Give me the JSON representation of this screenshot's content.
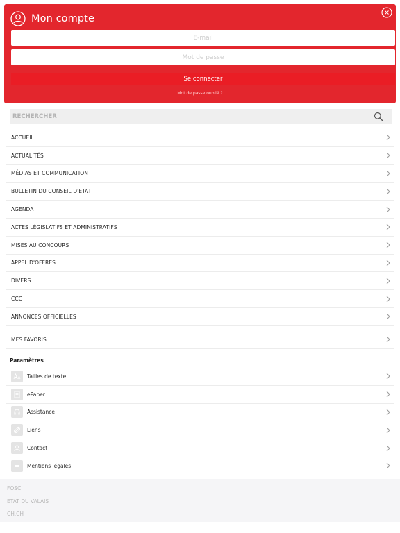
{
  "account": {
    "title": "Mon compte",
    "email_placeholder": "E-mail",
    "password_placeholder": "Mot de passe",
    "login_label": "Se connecter",
    "forgot_label": "Mot de passe oublié ?"
  },
  "search": {
    "placeholder": "RECHERCHER"
  },
  "menu": {
    "items": [
      {
        "label": "ACCUEIL"
      },
      {
        "label": "ACTUALITÉS"
      },
      {
        "label": "MÉDIAS ET COMMUNICATION"
      },
      {
        "label": "BULLETIN DU CONSEIL D'ETAT"
      },
      {
        "label": "AGENDA"
      },
      {
        "label": "ACTES LÉGISLATIFS ET ADMINISTRATIFS"
      },
      {
        "label": "MISES AU CONCOURS"
      },
      {
        "label": "APPEL D'OFFRES"
      },
      {
        "label": "DIVERS"
      },
      {
        "label": "CCC"
      },
      {
        "label": "ANNONCES OFFICIELLES"
      }
    ],
    "favoris_label": "MES FAVORIS"
  },
  "params": {
    "title": "Paramètres",
    "items": [
      {
        "label": "Tailles de texte",
        "icon": "text-size-icon"
      },
      {
        "label": "ePaper",
        "icon": "epaper-icon"
      },
      {
        "label": "Assistance",
        "icon": "assistance-icon"
      },
      {
        "label": "Liens",
        "icon": "link-icon"
      },
      {
        "label": "Contact",
        "icon": "contact-icon"
      },
      {
        "label": "Mentions légales",
        "icon": "legal-icon"
      }
    ]
  },
  "footer": {
    "links": [
      "FOSC",
      "ETAT DU VALAIS",
      "CH.CH"
    ]
  },
  "colors": {
    "brand_red": "#e3262d",
    "button_red": "#ea1d25",
    "search_bg": "#efefef",
    "footer_bg": "#f5f5f7"
  }
}
